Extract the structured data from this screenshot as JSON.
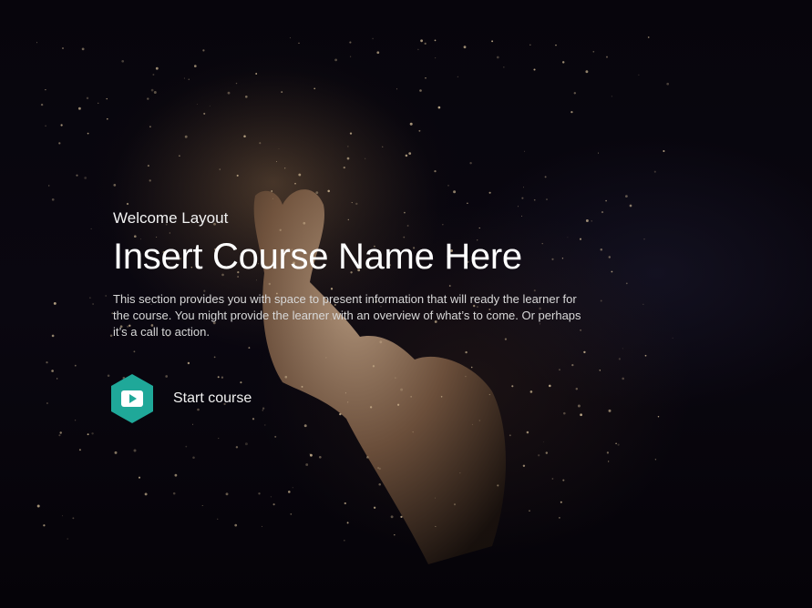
{
  "slide": {
    "eyebrow": "Welcome Layout",
    "title": "Insert Course Name Here",
    "description": "This section provides you with space to present information that will ready the learner for the course. You might provide the learner with an overview of what’s to come. Or perhaps it’s a call to action."
  },
  "cta": {
    "label": "Start course",
    "icon": "play-icon"
  },
  "colors": {
    "accent": "#1fa899",
    "background": "#06040a"
  }
}
